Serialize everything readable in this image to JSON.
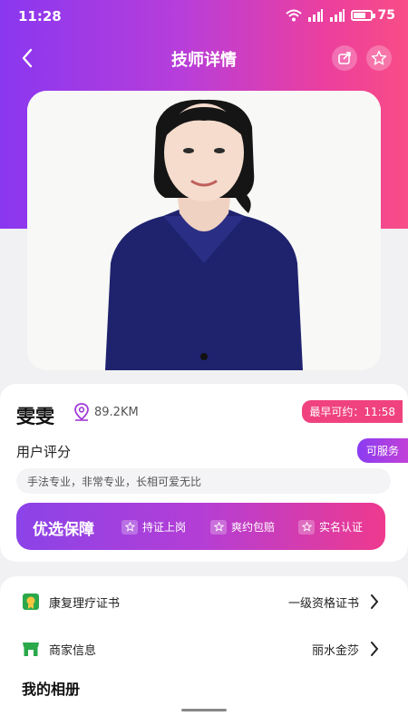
{
  "status": {
    "time": "11:28",
    "battery": "75",
    "battery_level": 0.75
  },
  "nav": {
    "title": "技师详情"
  },
  "profile": {
    "name": "雯雯",
    "distance": "89.2KM",
    "earliest_label": "最早可约：11:58",
    "rating_label": "用户评分",
    "availability": "可服务",
    "comment": "手法专业，非常专业，长相可爱无比"
  },
  "guarantee": {
    "title": "优选保障",
    "items": [
      "持证上岗",
      "爽约包赔",
      "实名认证"
    ]
  },
  "details": {
    "certificate": {
      "label": "康复理疗证书",
      "value": "一级资格证书"
    },
    "merchant": {
      "label": "商家信息",
      "value": "丽水金莎"
    }
  },
  "album": {
    "title": "我的相册"
  },
  "colors": {
    "gradient_start": "#8a37f0",
    "gradient_end": "#f84d86",
    "accent_pink": "#f0427e",
    "cert_icon": "#2aa84a"
  },
  "icons": [
    "back-icon",
    "share-icon",
    "favorite-star-icon",
    "location-pin-icon",
    "certificate-icon",
    "shop-icon",
    "chevron-right-icon"
  ]
}
